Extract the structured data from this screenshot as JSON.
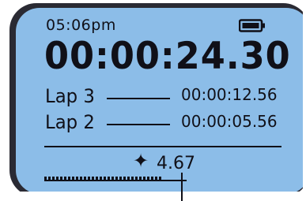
{
  "status": {
    "clock": "05:06pm",
    "battery_icon": "battery-full-icon"
  },
  "stopwatch": {
    "elapsed": "00:00:24.30"
  },
  "laps": [
    {
      "label": "Lap 3",
      "time": "00:00:12.56"
    },
    {
      "label": "Lap 2",
      "time": "00:00:05.56"
    }
  ],
  "split": {
    "icon": "plus-icon",
    "value": "4.67"
  },
  "colors": {
    "screen": "#8cbde8",
    "text": "#101018",
    "bezel": "#3a3a44"
  }
}
